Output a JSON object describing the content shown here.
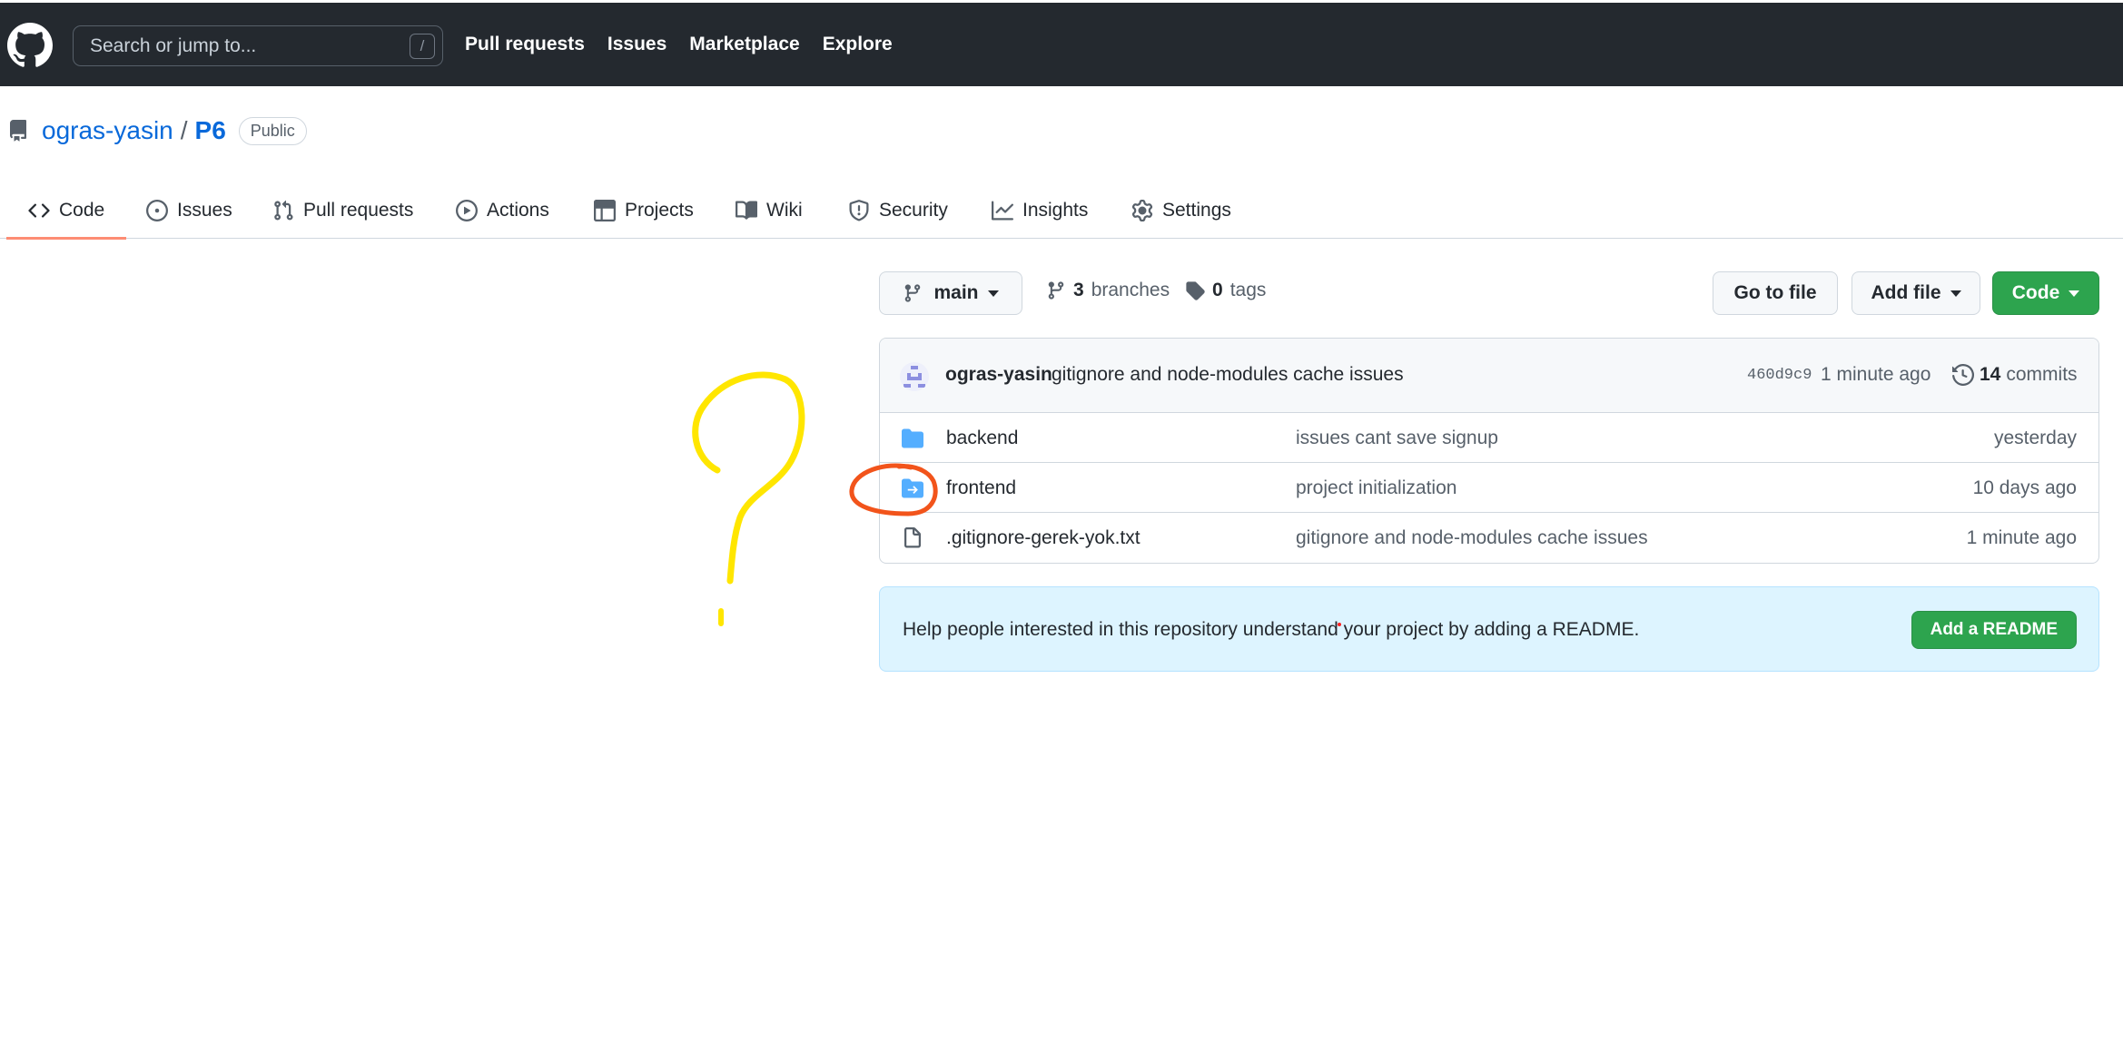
{
  "header": {
    "search_placeholder": "Search or jump to...",
    "search_shortcut": "/",
    "nav": [
      "Pull requests",
      "Issues",
      "Marketplace",
      "Explore"
    ]
  },
  "repo": {
    "owner": "ogras-yasin",
    "separator": "/",
    "name": "P6",
    "visibility": "Public"
  },
  "tabs": [
    {
      "label": "Code",
      "icon": "code-icon",
      "active": true
    },
    {
      "label": "Issues",
      "icon": "issue-opened-icon"
    },
    {
      "label": "Pull requests",
      "icon": "git-pull-request-icon"
    },
    {
      "label": "Actions",
      "icon": "play-icon"
    },
    {
      "label": "Projects",
      "icon": "table-icon"
    },
    {
      "label": "Wiki",
      "icon": "book-icon"
    },
    {
      "label": "Security",
      "icon": "shield-icon"
    },
    {
      "label": "Insights",
      "icon": "graph-icon"
    },
    {
      "label": "Settings",
      "icon": "gear-icon"
    }
  ],
  "toolbar": {
    "branch": "main",
    "branches_count": "3",
    "branches_label": "branches",
    "tags_count": "0",
    "tags_label": "tags",
    "goto_file": "Go to file",
    "add_file": "Add file",
    "code": "Code"
  },
  "latest_commit": {
    "author": "ogras-yasin",
    "message": "gitignore and node-modules cache issues",
    "sha": "460d9c9",
    "time": "1 minute ago",
    "commits_count": "14",
    "commits_label": "commits"
  },
  "files": [
    {
      "name": "backend",
      "type": "folder",
      "message": "issues cant save signup",
      "time": "yesterday"
    },
    {
      "name": "frontend",
      "type": "submodule-folder",
      "message": "project initialization",
      "time": "10 days ago"
    },
    {
      "name": ".gitignore-gerek-yok.txt",
      "type": "file",
      "message": "gitignore and node-modules cache issues",
      "time": "1 minute ago"
    }
  ],
  "readme_banner": {
    "text": "Help people interested in this repository understand your project by adding a README.",
    "button": "Add a README"
  },
  "colors": {
    "header_bg": "#24292f",
    "link": "#0969da",
    "green": "#2da44e",
    "tab_underline": "#fd8c73",
    "folder": "#54aeff",
    "annotation_yellow": "#ffe600",
    "annotation_orange": "#f2541b",
    "banner_bg": "#ddf4ff"
  }
}
